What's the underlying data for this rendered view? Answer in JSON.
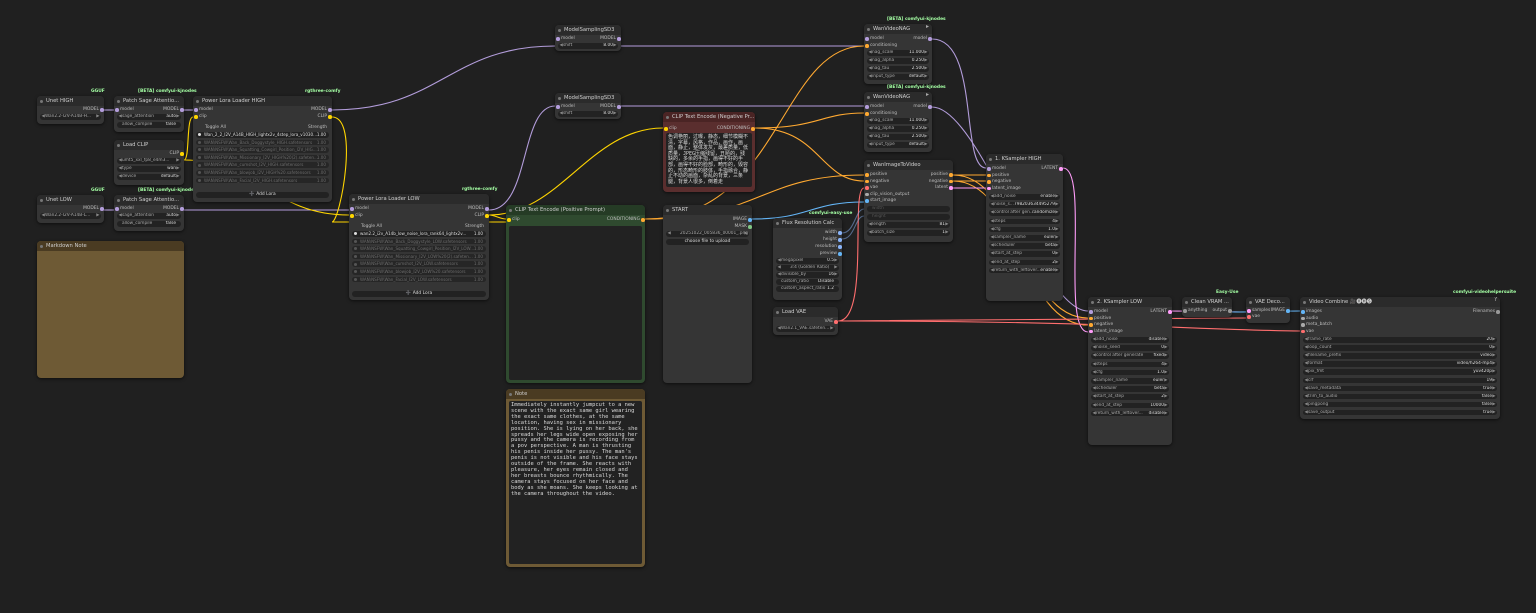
{
  "colors": {
    "canvas": "#202020",
    "node": "#353535",
    "header": "#2b2b2b",
    "badge": "#a4ffa4",
    "model_wire": "#b39ddb",
    "clip_wire": "#ffd500",
    "cond_wire": "#ffa931",
    "latent_wire": "#ff9cf9",
    "image_wire": "#64b5f6",
    "vae_wire": "#ff6e6e",
    "green_node": "#2f4a2f",
    "red_node": "#5a2e2e",
    "note_node": "#6e5a35"
  },
  "nodes": {
    "unet_high": {
      "badge": "GGUF",
      "title": "Unet HIGH",
      "out_model": "MODEL",
      "unet_name": "Wan2.2-I2V-A14B-H..."
    },
    "unet_low": {
      "badge": "GGUF",
      "title": "Unet LOW",
      "out_model": "MODEL",
      "unet_name": "Wan2.2-I2V-A14B-L..."
    },
    "sage_high": {
      "badge": "[BETA] comfyui-kjnodes",
      "title": "Patch Sage Attentio...",
      "in_model": "model",
      "out_model": "MODEL",
      "w1_label": "sage_attention",
      "w1_value": "auto",
      "w2_label": "allow_compile",
      "w2_value": "false"
    },
    "sage_low": {
      "badge": "[BETA] comfyui-kjnodes",
      "title": "Patch Sage Attentio...",
      "in_model": "model",
      "out_model": "MODEL",
      "w1_label": "sage_attention",
      "w1_value": "auto",
      "w2_label": "allow_compile",
      "w2_value": "false"
    },
    "load_clip": {
      "title": "Load CLIP",
      "out_clip": "CLIP",
      "clip_name": "umt5_xxl_fp8_e4m3...",
      "type_label": "type",
      "type_value": "wan",
      "device_label": "device",
      "device_value": "default"
    },
    "lora_high": {
      "badge": "rgthree-comfy",
      "title": "Power Lora Loader HIGH",
      "in_model": "model",
      "in_clip": "clip",
      "out_model": "MODEL",
      "out_clip": "CLIP",
      "toggle_all": "Toggle All",
      "strength_header": "Strength",
      "loras": [
        {
          "name": "Wan_2_2_I2V_A14B_HIGH_lightx2v_4step_lora_v1030...",
          "strength": "1.00",
          "on": true
        },
        {
          "name": "WAN\\NSFW\\Wan_Back_Doggystyle_HIGH.safetensors",
          "strength": "1.00",
          "on": false
        },
        {
          "name": "WAN\\NSFW\\Wan_Squatting_Cowgirl_Position_I2V_HIG...",
          "strength": "1.00",
          "on": false
        },
        {
          "name": "WAN\\NSFW\\Wan_Missionary_I2V_HIGH%20(2).safeten...",
          "strength": "1.00",
          "on": false
        },
        {
          "name": "WAN\\NSFW\\Wan_cumshot_I2V_HIGH.safetensors",
          "strength": "1.00",
          "on": false
        },
        {
          "name": "WAN\\NSFW\\Wan_blowjob_I2V_HIGH%20.safetensors",
          "strength": "1.00",
          "on": false
        },
        {
          "name": "WAN\\NSFW\\Wan_Facial_I2V_HIGH.safetensors",
          "strength": "1.00",
          "on": false
        }
      ],
      "add_lora": "➕ Add Lora"
    },
    "lora_low": {
      "badge": "rgthree-comfy",
      "title": "Power Lora Loader LOW",
      "in_model": "model",
      "in_clip": "clip",
      "out_model": "MODEL",
      "out_clip": "CLIP",
      "toggle_all": "Toggle All",
      "strength_header": "Strength",
      "loras": [
        {
          "name": "wan2.2_i2v_A14b_low_noise_lora_rank64_lightx2v...",
          "strength": "1.00",
          "on": true
        },
        {
          "name": "WAN\\NSFW\\Wan_Back_Doggystyle_LOW.safetensors",
          "strength": "1.00",
          "on": false
        },
        {
          "name": "WAN\\NSFW\\Wan_Squatting_Cowgirl_Position_I2V_LOW...",
          "strength": "1.00",
          "on": false
        },
        {
          "name": "WAN\\NSFW\\Wan_Missionary_I2V_LOW%20(2).safeten...",
          "strength": "1.00",
          "on": false
        },
        {
          "name": "WAN\\NSFW\\Wan_cumshot_I2V_LOW.safetensors",
          "strength": "1.00",
          "on": false
        },
        {
          "name": "WAN\\NSFW\\Wan_blowjob_I2V_LOW%20.safetensors",
          "strength": "1.00",
          "on": false
        },
        {
          "name": "WAN\\NSFW\\Wan_Facial_I2V_LOW.safetensors",
          "strength": "1.00",
          "on": false
        }
      ],
      "add_lora": "➕ Add Lora"
    },
    "markdown_note": {
      "title": "Markdown Note"
    },
    "msd3_1": {
      "title": "ModelSamplingSD3",
      "in_model": "model",
      "out_model": "MODEL",
      "shift_label": "shift",
      "shift_value": "8.00"
    },
    "msd3_2": {
      "title": "ModelSamplingSD3",
      "in_model": "model",
      "out_model": "MODEL",
      "shift_label": "shift",
      "shift_value": "8.00"
    },
    "clip_pos": {
      "title": "CLIP Text Encode (Positive Prompt)",
      "in_clip": "clip",
      "out_cond": "CONDITIONING"
    },
    "clip_neg": {
      "title": "CLIP Text Encode (Negative Pr...",
      "in_clip": "clip",
      "out_cond": "CONDITIONING",
      "text": "色调艳丽，过曝，静态，细节模糊不清，字幕，风格，作品，画作，画面，静止，整体发灰，最差质量，低质量，JPEG压缩残留，丑陋的，残缺的，多余的手指，画得不好的手部，画得不好的脸部，畸形的，毁容的，形态畸形的肢体，手指融合，静止不动的画面，杂乱的背景，三条腿，背景人很多，倒着走"
    },
    "note": {
      "title": "Note",
      "text": "Immediately instantly jumpcut to a new scene with the exact same girl wearing the exact same clothes, at the same location, having sex in missionary position. She is lying on her back, she spreads her legs wide open exposing her pussy and the camera is recording from a pov perspective. A man is thrusting his penis inside her pussy. The man's penis is not visible and his face stays outside of the frame. She reacts with pleasure, her eyes remain closed and her breasts bounce rhythmically. The camera stays focused on her face and body as she moans. She keeps looking at the camera throughout the video."
    },
    "start": {
      "title": "START",
      "out_image": "IMAGE",
      "out_mask": "MASK",
      "image_value": "20251022_005836_00001_.png",
      "upload": "choose file to upload"
    },
    "flux_res": {
      "badge": "comfyui-easy-use",
      "title": "Flux Resolution Calc",
      "out_width": "width",
      "out_height": "height",
      "out_resolution": "resolution",
      "out_preview": "preview",
      "mp_label": "megapixel",
      "mp_value": "0.5",
      "ratio_value": "3:4 (Golden Ratio)",
      "div_label": "divisible_by",
      "div_value": "16",
      "cr_label": "custom_ratio",
      "cr_value": "Disable",
      "car_label": "custom_aspect_ratio",
      "car_value": "1.2"
    },
    "load_vae": {
      "title": "Load VAE",
      "out_vae": "VAE",
      "vae_name": "Wan2.1_VAE.safeten..."
    },
    "wanimg": {
      "title": "WanImageToVideo",
      "ins": [
        "positive",
        "negative",
        "vae",
        "clip_vision_output",
        "start_image"
      ],
      "outs": [
        "positive",
        "negative",
        "latent"
      ],
      "width_label": "width",
      "height_label": "height",
      "length_label": "length",
      "length_value": "81",
      "batch_label": "batch_size",
      "batch_value": "1"
    },
    "nag1": {
      "badge": "[BETA] comfyui-kjnodes",
      "title": "WanVideoNAG",
      "in_model": "model",
      "in_cond": "conditioning",
      "out_model": "model",
      "w": [
        {
          "l": "nag_scale",
          "v": "11.000"
        },
        {
          "l": "nag_alpha",
          "v": "0.250"
        },
        {
          "l": "nag_tau",
          "v": "2.500"
        },
        {
          "l": "input_type",
          "v": "default"
        }
      ]
    },
    "nag2": {
      "badge": "[BETA] comfyui-kjnodes",
      "title": "WanVideoNAG",
      "in_model": "model",
      "in_cond": "conditioning",
      "out_model": "model",
      "w": [
        {
          "l": "nag_scale",
          "v": "11.000"
        },
        {
          "l": "nag_alpha",
          "v": "0.250"
        },
        {
          "l": "nag_tau",
          "v": "2.500"
        },
        {
          "l": "input_type",
          "v": "default"
        }
      ]
    },
    "ks_high": {
      "title": "1. KSampler HIGH",
      "ins": [
        "model",
        "positive",
        "negative",
        "latent_image"
      ],
      "out_latent": "LATENT",
      "w": [
        {
          "l": "add_noise",
          "v": "enable"
        },
        {
          "l": "noise_s...",
          "v": "798203634495279"
        },
        {
          "l": "control after gen...",
          "v": "randomize"
        },
        {
          "l": "steps",
          "v": "4"
        },
        {
          "l": "cfg",
          "v": "1.0"
        },
        {
          "l": "sampler_name",
          "v": "euler"
        },
        {
          "l": "scheduler",
          "v": "beta"
        },
        {
          "l": "start_at_step",
          "v": "0"
        },
        {
          "l": "end_at_step",
          "v": "2"
        },
        {
          "l": "return_with_leftover...",
          "v": "enable"
        }
      ]
    },
    "ks_low": {
      "title": "2. KSampler LOW",
      "ins": [
        "model",
        "positive",
        "negative",
        "latent_image"
      ],
      "out_latent": "LATENT",
      "w": [
        {
          "l": "add_noise",
          "v": "disable"
        },
        {
          "l": "noise_seed",
          "v": "0"
        },
        {
          "l": "control after generate",
          "v": "fixed"
        },
        {
          "l": "steps",
          "v": "4"
        },
        {
          "l": "cfg",
          "v": "1.0"
        },
        {
          "l": "sampler_name",
          "v": "euler"
        },
        {
          "l": "scheduler",
          "v": "beta"
        },
        {
          "l": "start_at_step",
          "v": "2"
        },
        {
          "l": "end_at_step",
          "v": "10000"
        },
        {
          "l": "return_with_leftover...",
          "v": "disable"
        }
      ]
    },
    "clean_vram": {
      "badge": "Easy-Use",
      "title": "Clean VRAM ...",
      "in_any": "anything",
      "out": "output"
    },
    "vae_decode": {
      "title": "VAE Deco...",
      "in_samples": "samples",
      "in_vae": "vae",
      "out_image": "IMAGE"
    },
    "video_combine": {
      "badge": "comfyui-videohelpersuite",
      "title": "Video Combine 🎥🅥🅗🅢",
      "ins": [
        "images",
        "audio",
        "meta_batch",
        "vae"
      ],
      "out": "Filenames",
      "w": [
        {
          "l": "frame_rate",
          "v": "20"
        },
        {
          "l": "loop_count",
          "v": "0"
        },
        {
          "l": "filename_prefix",
          "v": "video"
        },
        {
          "l": "format",
          "v": "video/h264-mp4"
        },
        {
          "l": "pix_fmt",
          "v": "yuv420p"
        },
        {
          "l": "crf",
          "v": "19"
        },
        {
          "l": "save_metadata",
          "v": "true"
        },
        {
          "l": "trim_to_audio",
          "v": "false"
        },
        {
          "l": "pingpong",
          "v": "false"
        },
        {
          "l": "save_output",
          "v": "true"
        }
      ]
    }
  }
}
